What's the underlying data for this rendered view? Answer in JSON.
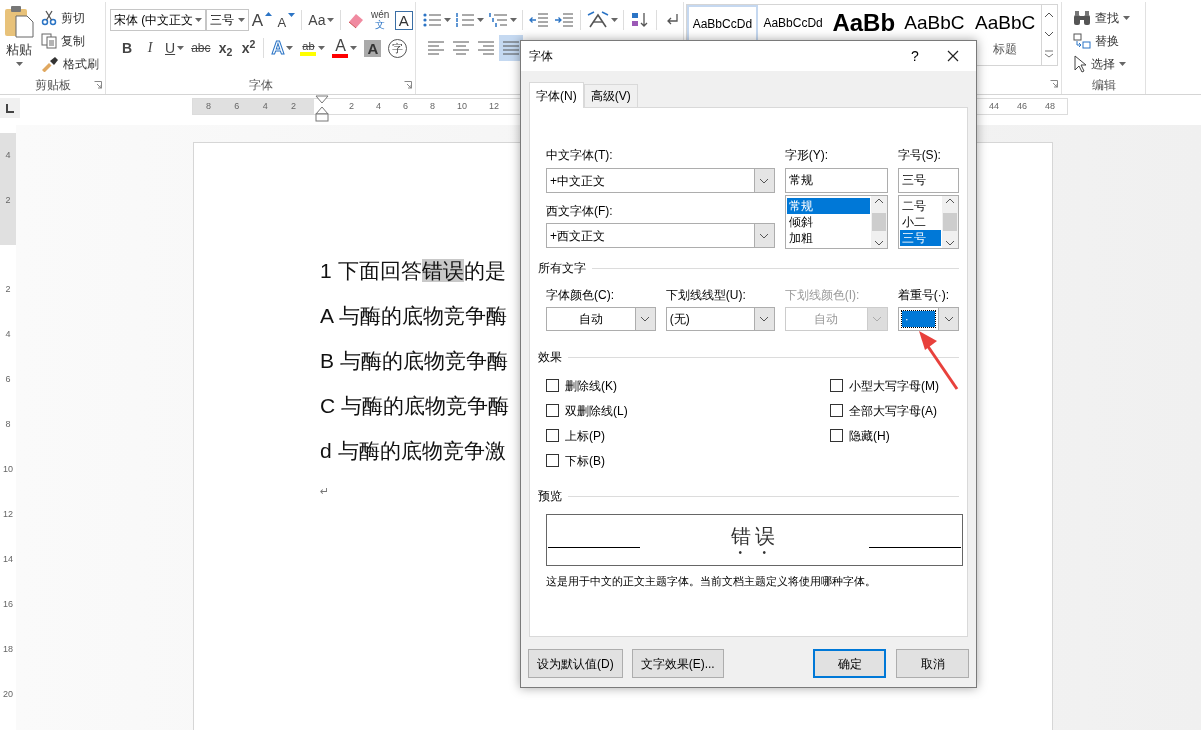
{
  "clipboard": {
    "paste": "粘贴",
    "cut": "剪切",
    "copy": "复制",
    "format_painter": "格式刷",
    "label": "剪贴板"
  },
  "font_group": {
    "font_name": "宋体 (中文正文",
    "font_size": "三号",
    "label": "字体",
    "row1": [
      {
        "kind": "grow",
        "label": "A"
      },
      {
        "kind": "shrink",
        "label": "A"
      },
      {
        "kind": "case",
        "label": "Aa"
      },
      {
        "kind": "clear"
      },
      {
        "kind": "phonetic",
        "label": "wén",
        "sub": "文"
      },
      {
        "kind": "border",
        "label": "A"
      }
    ],
    "row2": [
      {
        "kind": "bold",
        "label": "B"
      },
      {
        "kind": "italic",
        "label": "I"
      },
      {
        "kind": "underline",
        "label": "U"
      },
      {
        "kind": "strike",
        "label": "abc"
      },
      {
        "kind": "subscript",
        "label": "x$_{2}$"
      },
      {
        "kind": "superscript",
        "label": "x$^{2}$"
      },
      {
        "kind": "effects",
        "label": "A"
      },
      {
        "kind": "highlight",
        "label": "ab",
        "color": "#ffff00"
      },
      {
        "kind": "color",
        "label": "A",
        "color": "#ff0000"
      },
      {
        "kind": "shading",
        "label": "A"
      },
      {
        "kind": "enclose",
        "label": "字"
      }
    ]
  },
  "paragraph_group": {
    "row1": [
      {
        "kind": "bullets"
      },
      {
        "kind": "numbering"
      },
      {
        "kind": "multilevel"
      },
      {
        "kind": "outdent"
      },
      {
        "kind": "indent"
      },
      {
        "kind": "direction"
      },
      {
        "kind": "sort"
      },
      {
        "kind": "marks"
      }
    ],
    "row2": [
      {
        "kind": "align-left",
        "selected": false
      },
      {
        "kind": "align-center",
        "selected": false
      },
      {
        "kind": "align-right",
        "selected": false
      },
      {
        "kind": "align-justify",
        "selected": true
      }
    ]
  },
  "styles_group": {
    "items": [
      {
        "preview": "AaBbCcDd",
        "kind": "normal",
        "selected": true
      },
      {
        "preview": "AaBbCcDd",
        "kind": "normal",
        "selected": false
      },
      {
        "preview": "AaBb",
        "kind": "heading1",
        "selected": false
      },
      {
        "preview": "AaBbC",
        "kind": "heading2",
        "selected": false
      },
      {
        "preview": "AaBbC",
        "kind": "title",
        "label": "标题",
        "selected": false
      }
    ]
  },
  "editing_group": {
    "find": "查找",
    "replace": "替换",
    "select": "选择",
    "label": "编辑"
  },
  "ruler": {
    "left_numbers": [
      "8",
      "6",
      "4",
      "2"
    ],
    "right_numbers": [
      "2",
      "4",
      "6",
      "8",
      "10",
      "12"
    ],
    "far_right_numbers": [
      "44",
      "46",
      "48"
    ]
  },
  "vertical_ruler": {
    "top_numbers": [
      "4",
      "2"
    ],
    "numbers": [
      "2",
      "4",
      "6",
      "8",
      "10",
      "12",
      "14",
      "16",
      "18",
      "20"
    ]
  },
  "document": {
    "paragraphs": [
      {
        "segments": [
          {
            "text": "1 下面回答",
            "highlighted": false
          },
          {
            "text": "错误",
            "highlighted": true
          },
          {
            "text": "的是",
            "highlighted": false
          }
        ]
      },
      {
        "segments": [
          {
            "text": "A 与酶的底物竞争酶",
            "highlighted": false
          }
        ]
      },
      {
        "segments": [
          {
            "text": "B 与酶的底物竞争酶",
            "highlighted": false
          }
        ]
      },
      {
        "segments": [
          {
            "text": "C 与酶的底物竞争酶",
            "highlighted": false
          }
        ]
      },
      {
        "segments": [
          {
            "text": "d 与酶的底物竞争激",
            "highlighted": false
          }
        ]
      }
    ],
    "paragraph_mark": "↵"
  },
  "dialog": {
    "title": "字体",
    "help": "?",
    "tabs": [
      {
        "label": "字体(N)",
        "selected": true
      },
      {
        "label": "高级(V)",
        "selected": false
      }
    ],
    "chinese_font": {
      "label": "中文字体(T):",
      "value": "+中文正文"
    },
    "western_font": {
      "label": "西文字体(F):",
      "value": "+西文正文"
    },
    "style": {
      "label": "字形(Y):",
      "value": "常规",
      "options": [
        {
          "text": "常规",
          "selected": true
        },
        {
          "text": "倾斜",
          "selected": false
        },
        {
          "text": "加粗",
          "selected": false
        }
      ]
    },
    "size": {
      "label": "字号(S):",
      "value": "三号",
      "options": [
        {
          "text": "二号",
          "selected": false
        },
        {
          "text": "小二",
          "selected": false
        },
        {
          "text": "三号",
          "selected": true
        }
      ]
    },
    "all_text": {
      "title": "所有文字",
      "fields": [
        {
          "kind": "color",
          "label": "字体颜色(C):",
          "value": "自动",
          "disabled": false,
          "focused": false
        },
        {
          "kind": "line",
          "label": "下划线线型(U):",
          "value": "(无)",
          "disabled": false,
          "focused": false
        },
        {
          "kind": "color",
          "label": "下划线颜色(I):",
          "value": "自动",
          "disabled": true,
          "focused": false
        },
        {
          "kind": "mark",
          "label": "着重号(·):",
          "value": "·",
          "disabled": false,
          "focused": true
        }
      ]
    },
    "effects": {
      "title": "效果",
      "columns": [
        [
          {
            "label": "删除线(K)",
            "checked": false
          },
          {
            "label": "双删除线(L)",
            "checked": false
          },
          {
            "label": "上标(P)",
            "checked": false
          },
          {
            "label": "下标(B)",
            "checked": false
          }
        ],
        [
          {
            "label": "小型大写字母(M)",
            "checked": false
          },
          {
            "label": "全部大写字母(A)",
            "checked": false
          },
          {
            "label": "隐藏(H)",
            "checked": false
          }
        ]
      ]
    },
    "preview": {
      "title": "预览",
      "text": "错误",
      "emphasis": true,
      "description": "这是用于中文的正文主题字体。当前文档主题定义将使用哪种字体。"
    },
    "left_buttons": [
      {
        "label": "设为默认值(D)",
        "default": false
      },
      {
        "label": "文字效果(E)...",
        "default": false
      }
    ],
    "right_buttons": [
      {
        "label": "确定",
        "default": true
      },
      {
        "label": "取消",
        "default": false
      }
    ]
  },
  "annotation": {
    "kind": "arrow"
  }
}
